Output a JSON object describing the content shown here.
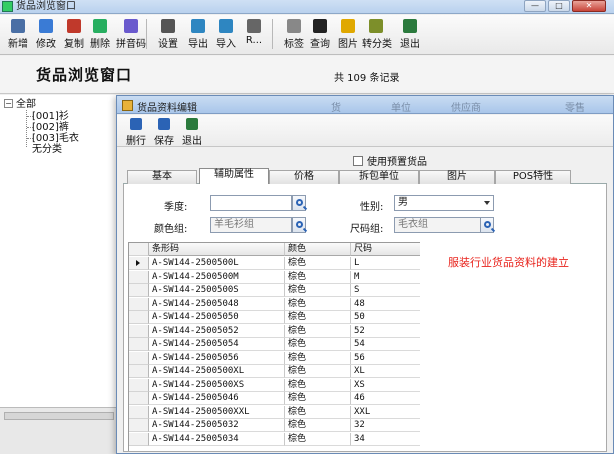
{
  "back_window": {
    "title": "货品浏览窗口",
    "heading": "货品浏览窗口",
    "record_count": "共 109 条记录",
    "window_buttons": {
      "minimize": "—",
      "maximize": "□",
      "close": "✕"
    },
    "toolbar": [
      {
        "label": "新增",
        "icon": "new-document-icon",
        "color": "#4a6fa5"
      },
      {
        "label": "修改",
        "icon": "edit-icon",
        "color": "#3a7bd5"
      },
      {
        "label": "复制",
        "icon": "copy-icon",
        "color": "#c0392b"
      },
      {
        "label": "删除",
        "icon": "delete-icon",
        "color": "#27ae60"
      },
      {
        "label": "拼音码",
        "icon": "pinyin-icon",
        "color": "#6a5acd"
      },
      {
        "label": "设置",
        "icon": "settings-icon",
        "color": "#555555"
      },
      {
        "label": "导出",
        "icon": "export-icon",
        "color": "#2e86c1"
      },
      {
        "label": "导入",
        "icon": "import-icon",
        "color": "#2e86c1"
      },
      {
        "label": "R...",
        "icon": "report-icon",
        "color": "#666666"
      },
      {
        "label": "标签",
        "icon": "label-icon",
        "color": "#888888"
      },
      {
        "label": "查询",
        "icon": "binoculars-icon",
        "color": "#222222"
      },
      {
        "label": "图片",
        "icon": "picture-icon",
        "color": "#e0a800"
      },
      {
        "label": "转分类",
        "icon": "reclassify-icon",
        "color": "#7d8f2a"
      },
      {
        "label": "退出",
        "icon": "exit-icon",
        "color": "#2b7a3d"
      }
    ],
    "tree": {
      "root": "全部",
      "expander": "−",
      "children": [
        "[001]衫",
        "[002]裤",
        "[003]毛衣",
        "无分类"
      ]
    }
  },
  "dialog": {
    "title": "货品资料编辑",
    "ghost_header": [
      "货",
      "单位",
      "供应商",
      "零售"
    ],
    "toolbar": [
      {
        "label": "删行",
        "icon": "delete-row-icon",
        "color": "#2b63b5"
      },
      {
        "label": "保存",
        "icon": "save-icon",
        "color": "#2b63b5"
      },
      {
        "label": "退出",
        "icon": "exit-icon",
        "color": "#2b7a3d"
      }
    ],
    "use_preset_label": "使用预置货品",
    "tabs": [
      "基本",
      "辅助属性",
      "价格",
      "拆包单位",
      "图片",
      "POS特性"
    ],
    "active_tab": 1,
    "form": {
      "season_label": "季度:",
      "season_value": "",
      "gender_label": "性别:",
      "gender_value": "男",
      "color_group_label": "颜色组:",
      "color_group_value": "羊毛衫组",
      "size_group_label": "尺码组:",
      "size_group_value": "毛衣组"
    },
    "grid": {
      "columns": [
        "条形码",
        "颜色",
        "尺码"
      ],
      "rows": [
        [
          "A-SW144-2500500L",
          "棕色",
          "L"
        ],
        [
          "A-SW144-2500500M",
          "棕色",
          "M"
        ],
        [
          "A-SW144-2500500S",
          "棕色",
          "S"
        ],
        [
          "A-SW144-25005048",
          "棕色",
          "48"
        ],
        [
          "A-SW144-25005050",
          "棕色",
          "50"
        ],
        [
          "A-SW144-25005052",
          "棕色",
          "52"
        ],
        [
          "A-SW144-25005054",
          "棕色",
          "54"
        ],
        [
          "A-SW144-25005056",
          "棕色",
          "56"
        ],
        [
          "A-SW144-2500500XL",
          "棕色",
          "XL"
        ],
        [
          "A-SW144-2500500XS",
          "棕色",
          "XS"
        ],
        [
          "A-SW144-25005046",
          "棕色",
          "46"
        ],
        [
          "A-SW144-2500500XXL",
          "棕色",
          "XXL"
        ],
        [
          "A-SW144-25005032",
          "棕色",
          "32"
        ],
        [
          "A-SW144-25005034",
          "棕色",
          "34"
        ]
      ],
      "selected_row": 0
    },
    "annotation": "服装行业货品资料的建立"
  }
}
